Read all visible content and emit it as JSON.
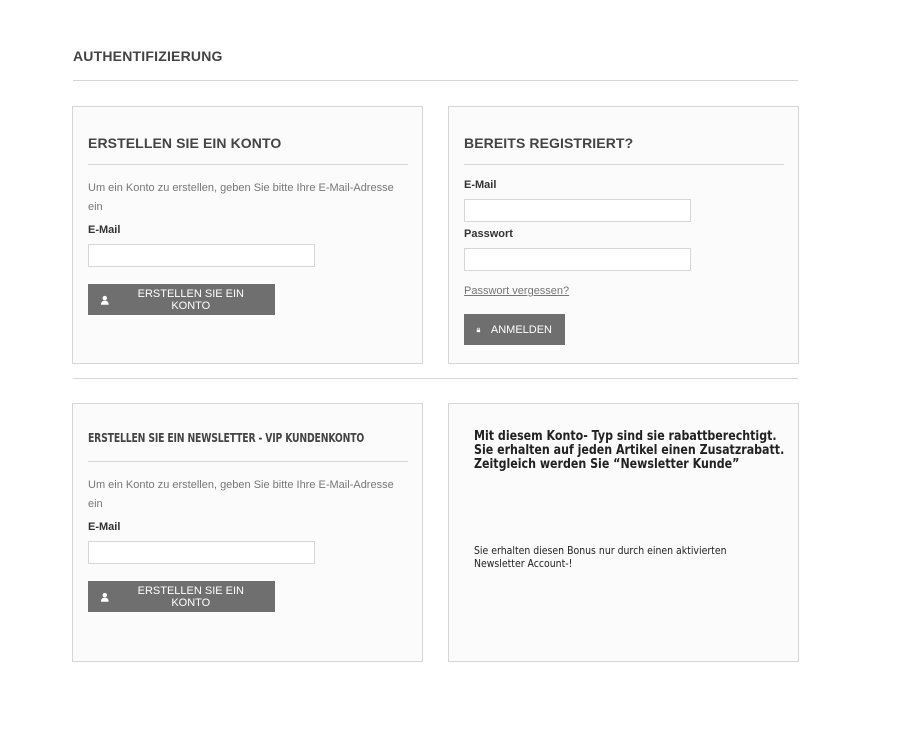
{
  "page": {
    "title": "AUTHENTIFIZIERUNG"
  },
  "create_account": {
    "title": "ERSTELLEN SIE EIN KONTO",
    "description": "Um ein Konto zu erstellen, geben Sie bitte Ihre E-Mail-Adresse ein",
    "email_label": "E-Mail",
    "email_value": "",
    "button_label": "ERSTELLEN SIE EIN KONTO",
    "button_icon": "user-icon"
  },
  "login": {
    "title": "BEREITS REGISTRIERT?",
    "email_label": "E-Mail",
    "email_value": "",
    "password_label": "Passwort",
    "password_value": "",
    "forgot_link": "Passwort vergessen?",
    "button_label": "ANMELDEN",
    "button_icon": "lock-icon"
  },
  "newsletter": {
    "title": "ERSTELLEN SIE EIN NEWSLETTER - VIP KUNDENKONTO",
    "description": "Um ein Konto zu erstellen, geben Sie bitte Ihre E-Mail-Adresse ein",
    "email_label": "E-Mail",
    "email_value": "",
    "button_label": "ERSTELLEN SIE EIN KONTO",
    "button_icon": "user-icon"
  },
  "info": {
    "line1": "Mit diesem Konto- Typ sind sie rabattberechtigt.",
    "line2": "Sie erhalten auf jeden Artikel einen Zusatzrabatt.",
    "line3": "Zeitgleich werden Sie “Newsletter Kunde”",
    "note_line1": "Sie erhalten diesen Bonus nur durch einen aktivierten",
    "note_line2": "Newsletter Account-!"
  },
  "colors": {
    "button_bg": "#6f6f6f",
    "box_bg": "#fbfbfb",
    "border": "#d6d6d6"
  }
}
